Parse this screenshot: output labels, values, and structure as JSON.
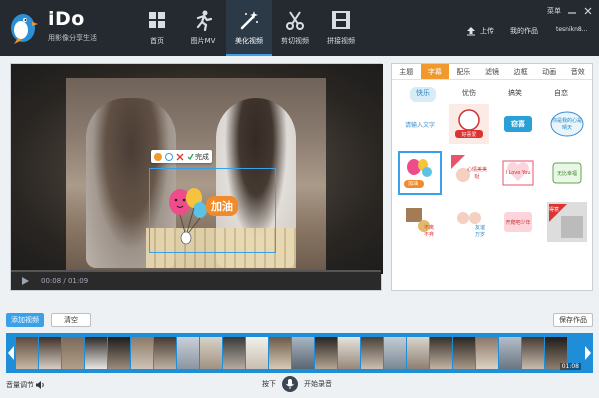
{
  "app": {
    "name": "iDo",
    "tagline": "用影像分享生活",
    "menu": "菜单"
  },
  "nav": [
    {
      "label": "首页",
      "icon": "grid-icon"
    },
    {
      "label": "图片MV",
      "icon": "runner-icon"
    },
    {
      "label": "美化视频",
      "icon": "magic-wand-icon",
      "active": true
    },
    {
      "label": "剪切视频",
      "icon": "scissors-icon"
    },
    {
      "label": "拼接视频",
      "icon": "film-icon"
    }
  ],
  "account": {
    "upload": "上传",
    "my_works": "我的作品",
    "username": "tesnikn8..."
  },
  "player": {
    "time": "00:08 / 01:09",
    "sticker_text": "加油",
    "toolbar_done": "完成"
  },
  "panel": {
    "tabs": [
      {
        "label": "主题"
      },
      {
        "label": "字幕",
        "active": true
      },
      {
        "label": "配乐"
      },
      {
        "label": "滤镜"
      },
      {
        "label": "边框"
      },
      {
        "label": "动画"
      },
      {
        "label": "音效"
      }
    ],
    "subtabs": [
      {
        "label": "快乐",
        "active": true
      },
      {
        "label": "忧伤"
      },
      {
        "label": "搞笑"
      },
      {
        "label": "自恋"
      }
    ],
    "stickers": [
      {
        "text": "请输入文字"
      },
      {
        "text": "好喜爱"
      },
      {
        "text": "窃喜"
      },
      {
        "text": "你是我的心是晴天"
      },
      {
        "text": "加油",
        "selected": true
      },
      {
        "text": "心情美美哒"
      },
      {
        "text": "I Love You"
      },
      {
        "text": "无比幸福"
      },
      {
        "text": "不离不弃"
      },
      {
        "text": "友谊万岁"
      },
      {
        "text": "开爬吧少年"
      },
      {
        "text": "得意"
      }
    ]
  },
  "actions": {
    "add_video": "添加视频",
    "clear": "清空",
    "save": "保存作品"
  },
  "timeline": {
    "duration": "01:08"
  },
  "bottom": {
    "volume": "音量调节",
    "press": "按下",
    "start_record": "开始录音"
  },
  "colors": {
    "header_bg": "#242a30",
    "accent_blue": "#3aa0e8",
    "accent_orange": "#f2992e"
  }
}
